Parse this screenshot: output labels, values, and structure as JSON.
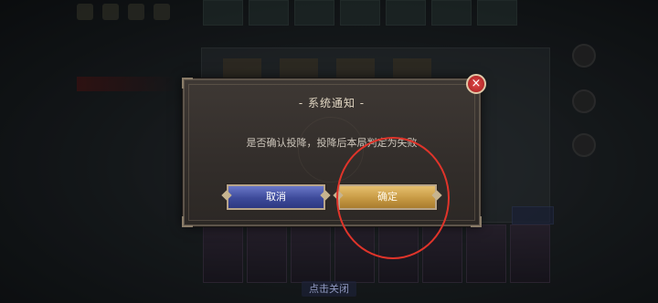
{
  "dialog": {
    "title": "- 系统通知 -",
    "message": "是否确认投降，投降后本局判定为失败",
    "cancel_label": "取消",
    "confirm_label": "确定",
    "close_icon": "×"
  },
  "footer": {
    "hint": "点击关闭"
  },
  "colors": {
    "cancel_button": "#3d4a9a",
    "confirm_button": "#c79a44",
    "close_button": "#c62828",
    "highlight": "#e0342a"
  }
}
